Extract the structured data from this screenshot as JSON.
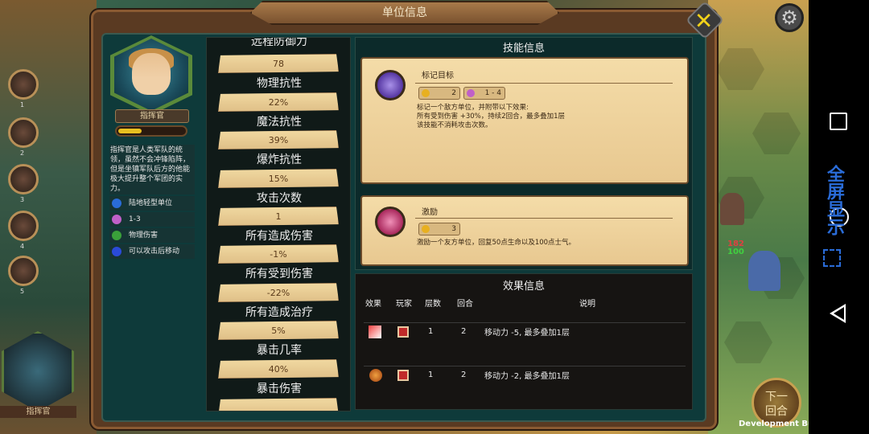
{
  "window": {
    "title": "单位信息"
  },
  "unit": {
    "name": "指挥官",
    "hp_fraction": 0.35,
    "description": "指挥官是人类军队的统领，虽然不会冲锋陷阵，但是坐镇军队后方的他能极大提升整个军团的实力。",
    "traits": [
      {
        "icon": "infantry-icon",
        "label": "陆地轻型单位",
        "color": "#2a6cd8"
      },
      {
        "icon": "range-icon",
        "label": "1-3",
        "color": "#c060c8"
      },
      {
        "icon": "physical-damage-icon",
        "label": "物理伤害",
        "color": "#3aa03a"
      },
      {
        "icon": "move-after-attack-icon",
        "label": "可以攻击后移动",
        "color": "#2a4ad8"
      }
    ]
  },
  "stats": [
    {
      "label": "远程防御力",
      "value": "78"
    },
    {
      "label": "物理抗性",
      "value": "22%"
    },
    {
      "label": "魔法抗性",
      "value": "39%"
    },
    {
      "label": "爆炸抗性",
      "value": "15%"
    },
    {
      "label": "攻击次数",
      "value": "1"
    },
    {
      "label": "所有造成伤害",
      "value": "-1%"
    },
    {
      "label": "所有受到伤害",
      "value": "-22%"
    },
    {
      "label": "所有造成治疗",
      "value": "5%"
    },
    {
      "label": "暴击几率",
      "value": "40%"
    },
    {
      "label": "暴击伤害",
      "value": ""
    }
  ],
  "skills": {
    "title": "技能信息",
    "items": [
      {
        "name": "标记目标",
        "icon": "target-mark-icon",
        "icon_color": "#6a4ac8",
        "cooldown": "2",
        "range": "1 - 4",
        "desc": [
          "标记一个敌方单位，并附带以下效果:",
          "所有受到伤害 +30%，持续2回合，最多叠加1层",
          "该技能不消耗攻击次数。"
        ]
      },
      {
        "name": "激励",
        "icon": "fist-inspire-icon",
        "icon_color": "#c02a60",
        "cooldown": "3",
        "desc": [
          "激励一个友方单位，回复50点生命以及100点士气。"
        ]
      }
    ]
  },
  "effects": {
    "title": "效果信息",
    "headers": {
      "effect": "效果",
      "player": "玩家",
      "stacks": "层数",
      "turns": "回合",
      "desc": "说明"
    },
    "rows": [
      {
        "icon": "slow-boot-icon",
        "stacks": "1",
        "turns": "2",
        "desc": "移动力 -5, 最多叠加1层"
      },
      {
        "icon": "slow-feather-icon",
        "stacks": "1",
        "turns": "2",
        "desc": "移动力 -2, 最多叠加1层"
      }
    ]
  },
  "sidebar": {
    "numbers": [
      "1",
      "2",
      "3",
      "4",
      "5"
    ],
    "commander_label": "指挥官"
  },
  "map": {
    "hp_red": "182",
    "hp_green": "100",
    "next_turn": "下一\n回合",
    "dev_build": "Development Build"
  },
  "system": {
    "fullscreen_label": "全屏显示"
  }
}
